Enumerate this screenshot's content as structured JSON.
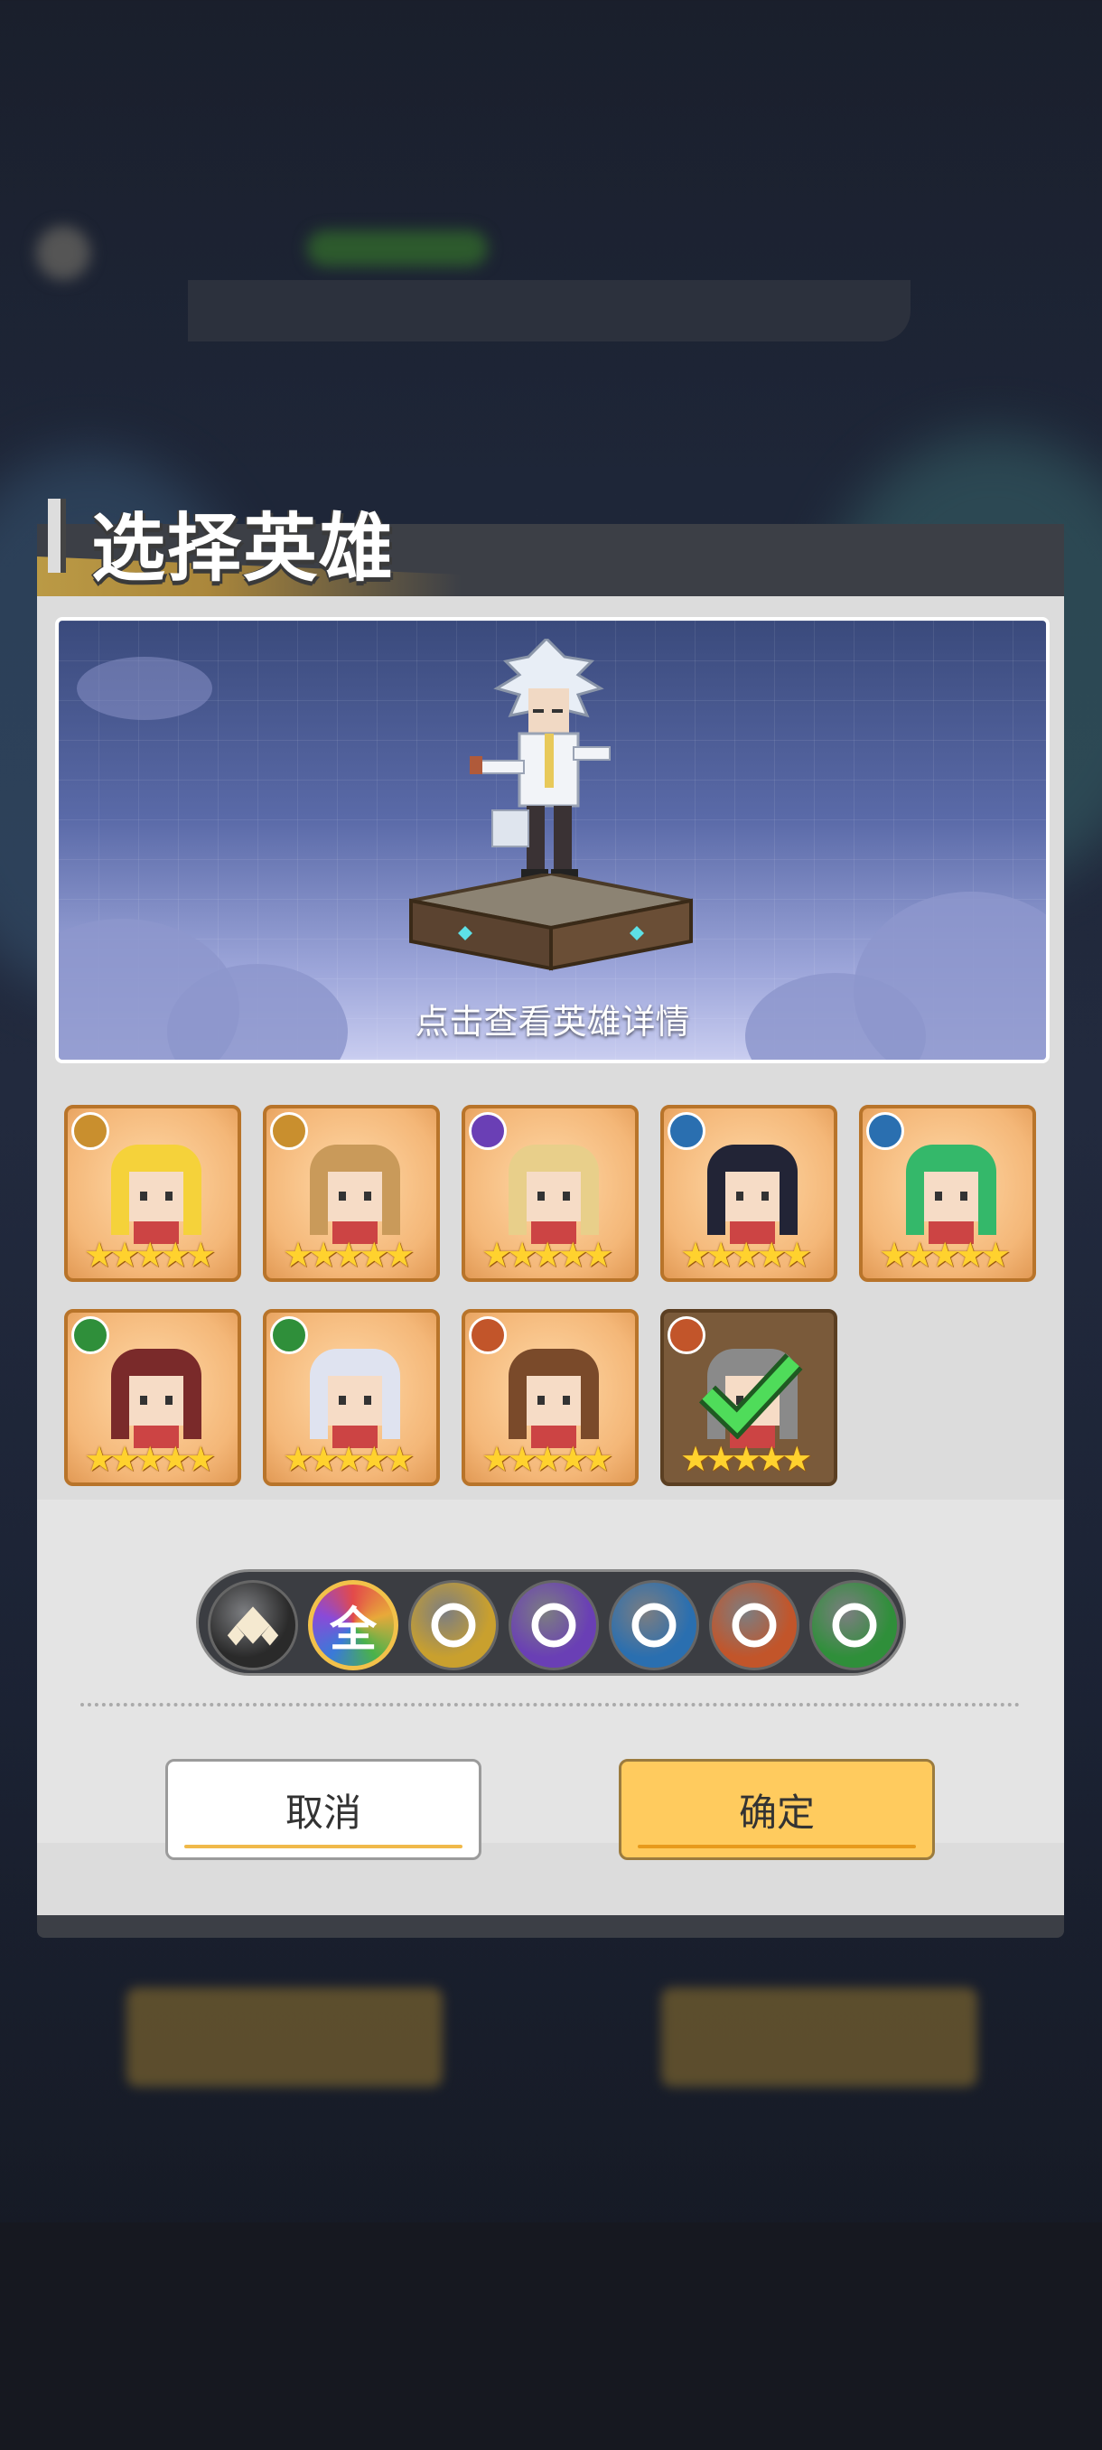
{
  "dialog": {
    "title": "选择英雄",
    "preview_tip": "点击查看英雄详情",
    "cancel_label": "取消",
    "confirm_label": "确定"
  },
  "heroes": [
    {
      "element": "lotus-icon",
      "element_color": "#c98f2e",
      "stars": "★★★★★",
      "hair": "#f5d23a",
      "selected": false
    },
    {
      "element": "lotus-icon",
      "element_color": "#c98f2e",
      "stars": "★★★★★",
      "hair": "#c99a5a",
      "selected": false
    },
    {
      "element": "flame-icon",
      "element_color": "#6a3fb5",
      "stars": "★★★★★",
      "hair": "#e8cf8a",
      "selected": false
    },
    {
      "element": "yin-yang-icon",
      "element_color": "#2a6fb0",
      "stars": "★★★★★",
      "hair": "#222436",
      "selected": false
    },
    {
      "element": "yin-yang-icon",
      "element_color": "#2a6fb0",
      "stars": "★★★★★",
      "hair": "#34b86a",
      "selected": false
    },
    {
      "element": "dna-icon",
      "element_color": "#2f8f3a",
      "stars": "★★★★★",
      "hair": "#7a2a2a",
      "selected": false
    },
    {
      "element": "dna-icon",
      "element_color": "#2f8f3a",
      "stars": "★★★★★",
      "hair": "#dfe3f0",
      "selected": false
    },
    {
      "element": "meditate-icon",
      "element_color": "#c2552a",
      "stars": "★★★★★",
      "hair": "#7a4a2a",
      "selected": false
    },
    {
      "element": "meditate-icon",
      "element_color": "#c2552a",
      "stars": "★★★★★",
      "hair": "#8a8a8a",
      "selected": true
    }
  ],
  "filters": [
    {
      "name": "type-filter-icon",
      "label": "",
      "color": "#2a2a2a"
    },
    {
      "name": "all-filter",
      "label": "全",
      "color": "#d98a2e"
    },
    {
      "name": "lotus-icon",
      "label": "",
      "color": "#c9a02e"
    },
    {
      "name": "flame-icon",
      "label": "",
      "color": "#6a3fb5"
    },
    {
      "name": "yin-yang-icon",
      "label": "",
      "color": "#2a6fb0"
    },
    {
      "name": "meditate-icon",
      "label": "",
      "color": "#c2552a"
    },
    {
      "name": "dna-icon",
      "label": "",
      "color": "#2f8f3a"
    }
  ]
}
